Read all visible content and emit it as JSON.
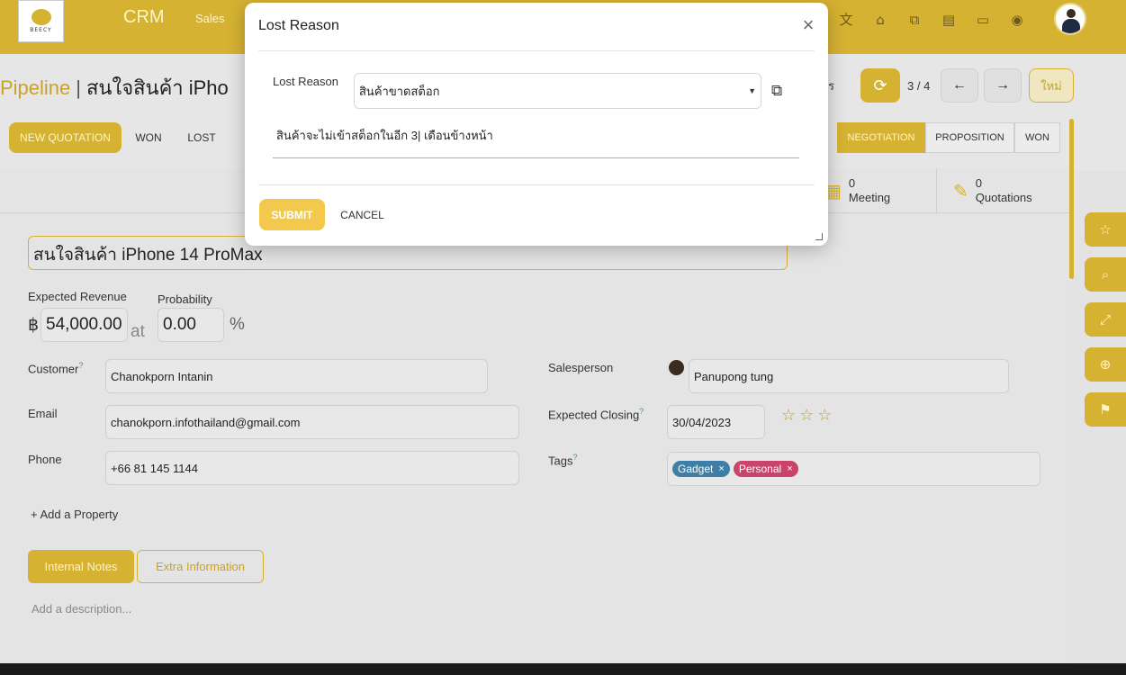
{
  "topbar": {
    "logo_text": "BEECY",
    "app_name": "CRM",
    "nav_item": "Sales",
    "icons": [
      "translate-icon",
      "bank-icon",
      "code-icon",
      "paint-roller-icon",
      "note-icon",
      "lightbulb-icon"
    ]
  },
  "breadcrumb": {
    "parent": "Pipeline",
    "separator": "|",
    "current": "สนใจสินค้า iPho"
  },
  "control": {
    "actions_label": "าร",
    "pager": "3 / 4",
    "new_label": "ใหม่"
  },
  "status_bar": {
    "new_quotation": "NEW QUOTATION",
    "won": "WON",
    "lost": "LOST",
    "stages": [
      {
        "label": "NEGOTIATION",
        "active": true
      },
      {
        "label": "PROPOSITION",
        "active": false
      },
      {
        "label": "WON",
        "active": false
      }
    ]
  },
  "stats": [
    {
      "count": "0",
      "label": "Meeting",
      "icon": "calendar-icon"
    },
    {
      "count": "0",
      "label": "Quotations",
      "icon": "pencil-square-icon"
    }
  ],
  "form": {
    "title": "สนใจสินค้า iPhone 14 ProMax",
    "expected_revenue_label": "Expected Revenue",
    "currency_symbol": "฿",
    "expected_revenue": "54,000.00",
    "at_label": "at",
    "probability_label": "Probability",
    "probability": "0.00",
    "percent": "%",
    "customer_label": "Customer",
    "customer": "Chanokporn Intanin",
    "email_label": "Email",
    "email": "chanokporn.infothailand@gmail.com",
    "phone_label": "Phone",
    "phone": "+66 81 145 1144",
    "salesperson_label": "Salesperson",
    "salesperson": "Panupong tung",
    "expected_closing_label": "Expected Closing",
    "expected_closing": "30/04/2023",
    "priority_stars": "☆☆☆",
    "tags_label": "Tags",
    "tags": [
      {
        "label": "Gadget",
        "color": "#3d7fa6"
      },
      {
        "label": "Personal",
        "color": "#c9436b"
      }
    ],
    "tag_remove": "×",
    "help_mark": "?",
    "add_property": "+ Add a Property",
    "tab_notes": "Internal Notes",
    "tab_extra": "Extra Information",
    "description_placeholder": "Add a description..."
  },
  "modal": {
    "title": "Lost Reason",
    "close": "×",
    "lost_reason_label": "Lost Reason",
    "lost_reason_value": "สินค้าขาดสต็อก",
    "note": "สินค้าจะไม่เข้าสต็อกในอีก 3| เดือนข้างหน้า",
    "submit": "SUBMIT",
    "cancel": "CANCEL"
  },
  "side_buttons": [
    "star-icon",
    "search-icon",
    "expand-icon",
    "zoom-in-icon",
    "bookmark-icon"
  ],
  "colors": {
    "brand": "#d6b233",
    "submit": "#f2c94c"
  }
}
